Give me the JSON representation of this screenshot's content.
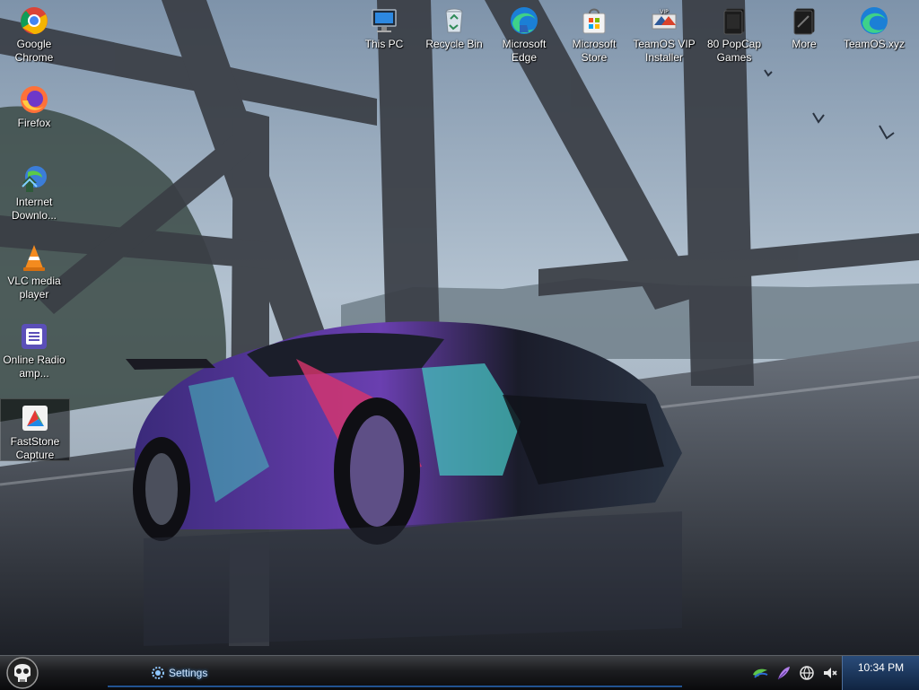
{
  "desktop": {
    "icons_left": [
      {
        "id": "chrome",
        "label": "Google Chrome",
        "icon": "chrome-icon"
      },
      {
        "id": "firefox",
        "label": "Firefox",
        "icon": "firefox-icon"
      },
      {
        "id": "idm",
        "label": "Internet Downlo...",
        "icon": "internet-download-manager-icon"
      },
      {
        "id": "vlc",
        "label": "VLC media player",
        "icon": "vlc-cone-icon"
      },
      {
        "id": "radio",
        "label": "Online Radio amp...",
        "icon": "radio-app-icon"
      },
      {
        "id": "faststone",
        "label": "FastStone Capture",
        "icon": "faststone-capture-icon"
      }
    ],
    "icons_top": [
      {
        "id": "thispc",
        "label": "This PC",
        "icon": "computer-monitor-icon"
      },
      {
        "id": "recycle",
        "label": "Recycle Bin",
        "icon": "recycle-bin-icon"
      },
      {
        "id": "edge",
        "label": "Microsoft Edge",
        "icon": "edge-icon"
      },
      {
        "id": "store",
        "label": "Microsoft Store",
        "icon": "store-bag-icon"
      },
      {
        "id": "teamos",
        "label": "TeamOS VIP Installer",
        "icon": "teamos-installer-icon"
      },
      {
        "id": "popcap",
        "label": "80 PopCap Games",
        "icon": "popcap-games-icon"
      },
      {
        "id": "more",
        "label": "More",
        "icon": "more-games-icon"
      },
      {
        "id": "teamosxyz",
        "label": "TeamOS.xyz",
        "icon": "edge-shortcut-icon"
      }
    ],
    "selected": "faststone"
  },
  "taskbar": {
    "start_icon": "skull-orb-icon",
    "open_window": {
      "label": "Settings",
      "icon": "gear-icon"
    },
    "tray_icons": [
      "security-shield-icon",
      "feather-icon",
      "network-globe-icon",
      "volume-muted-icon"
    ],
    "clock": "10:34 PM"
  },
  "colors": {
    "taskbar_dark": "#0a0a0c",
    "clock_blue": "#1c3a63",
    "glow_blue": "#4aa3ff"
  }
}
